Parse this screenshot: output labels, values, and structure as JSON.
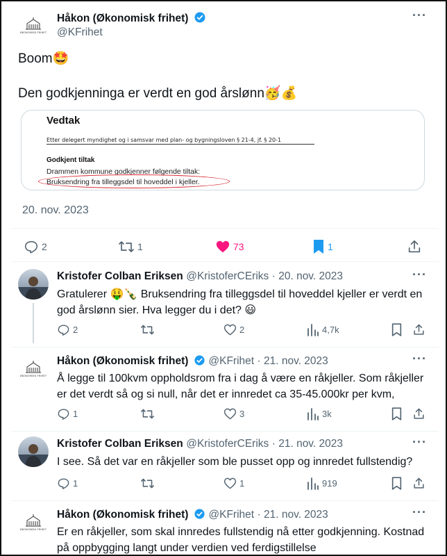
{
  "main_tweet": {
    "author_name": "Håkon (Økonomisk frihet)",
    "handle": "@KFrihet",
    "line1": "Boom🤩",
    "line2": "Den godkjenninga er verdt en god årslønn🥳💰",
    "date": "20. nov. 2023",
    "document": {
      "title": "Vedtak",
      "line1": "Etter delegert myndighet og i samsvar med plan- og bygningsloven § 21-4, jf. § 20-1",
      "subtitle": "Godkjent tiltak",
      "line2": "Drammen kommune godkjenner følgende tiltak:",
      "line3": "Bruksendring fra tilleggsdel til hoveddel i kjeller."
    },
    "stats": {
      "replies": "2",
      "retweets": "1",
      "likes": "73",
      "bookmarks": "1"
    },
    "colors": {
      "like": "#f91880",
      "bookmark": "#1d9bf0"
    }
  },
  "avatar_logo_text": "ØKONOMISK FRIHET",
  "replies": [
    {
      "name": "Kristofer Colban Eriksen",
      "handle": "@KristoferCEriks",
      "date": "· 20. nov. 2023",
      "line1": "Gratulerer 🤑🍾 Bruksendring fra tilleggsdel til hoveddel kjeller er verdt en",
      "line2": "god årslønn sier. Hva legger du i det? 😃",
      "replies": "2",
      "retweets": "",
      "likes": "2",
      "views": "4,7k"
    },
    {
      "name": "Håkon (Økonomisk frihet)",
      "handle": "@KFrihet",
      "date": "· 21. nov. 2023",
      "line1": "Å legge til 100kvm oppholdsrom fra i dag å være en råkjeller. Som råkjeller",
      "line2": "er det verdt så og si null, når det er innredet ca 35-45.000kr per kvm,",
      "replies": "1",
      "retweets": "",
      "likes": "3",
      "views": "3k"
    },
    {
      "name": "Kristofer Colban Eriksen",
      "handle": "@KristoferCEriks",
      "date": "· 21. nov. 2023",
      "line1": "I see. Så det var en råkjeller som ble pusset opp og innredet fullstendig?",
      "line2": "",
      "replies": "1",
      "retweets": "",
      "likes": "1",
      "views": "919"
    },
    {
      "name": "Håkon (Økonomisk frihet)",
      "handle": "@KFrihet",
      "date": "· 21. nov. 2023",
      "line1": "Er en råkjeller, som skal innredes fullstendig nå etter godkjenning. Kostnad",
      "line2": "på oppbygging langt under verdien ved ferdigstillelse"
    }
  ],
  "more_label": "···"
}
